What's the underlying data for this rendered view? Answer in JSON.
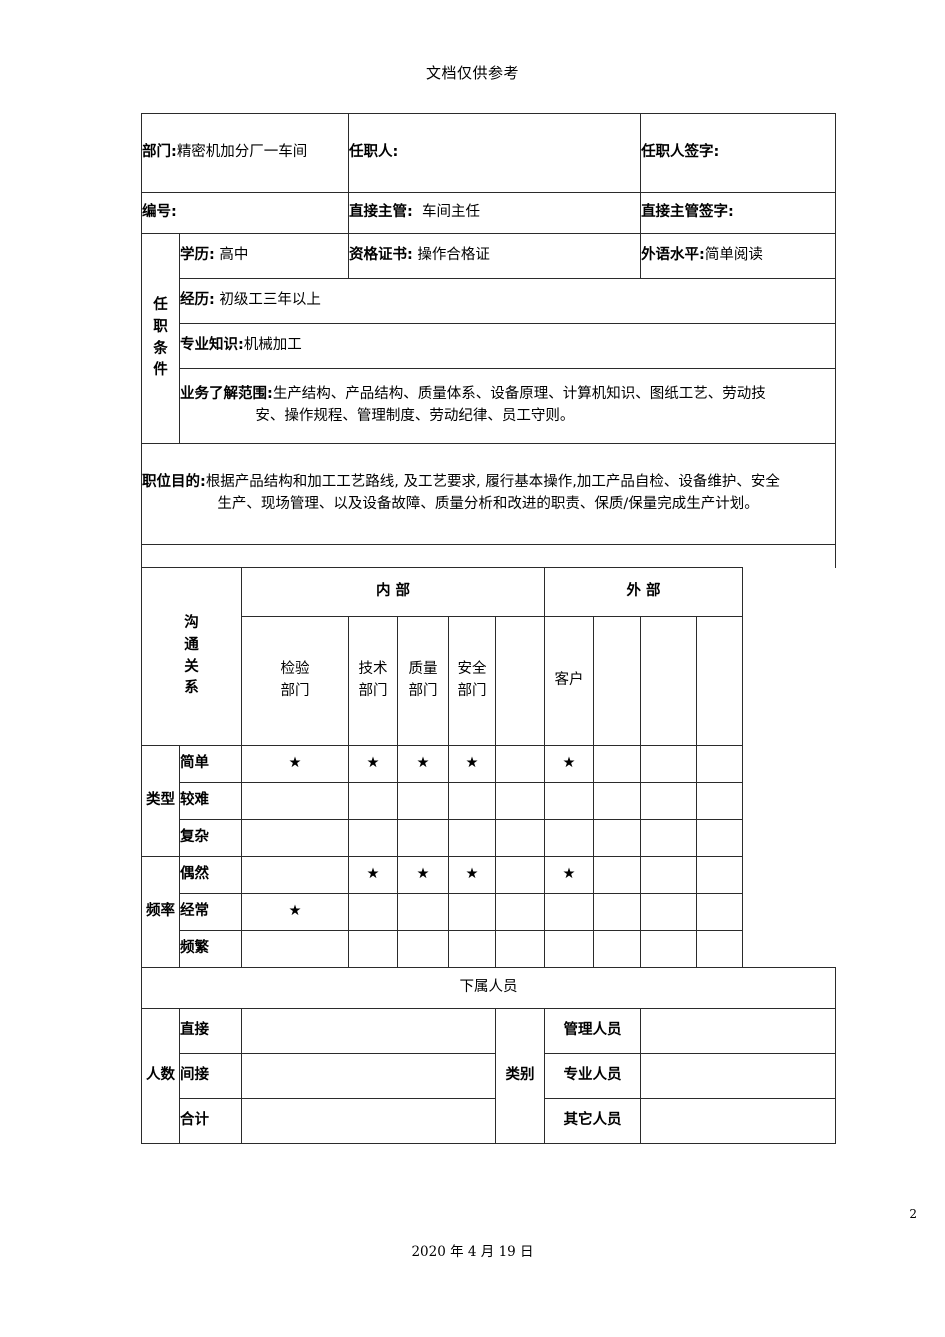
{
  "document": {
    "header_note": "文档仅供参考",
    "footer_date": "2020 年 4 月 19 日",
    "page_number": "2"
  },
  "identity": {
    "department_label": "部门:",
    "department_value": "精密机加分厂一车间",
    "department_full": "部门:精密机加分厂一车间",
    "incumbent_label": "任职人:",
    "incumbent_value": "",
    "incumbent_signature_label": "任职人签字:",
    "incumbent_signature_value": "",
    "number_label": "编号:",
    "number_value": "",
    "supervisor_label": "直接主管:",
    "supervisor_value": "车间主任",
    "supervisor_signature_label": "直接主管签字:",
    "supervisor_signature_value": ""
  },
  "qualifications": {
    "section_label": "任职条件",
    "section_label_chars": [
      "任",
      "职",
      "条",
      "件"
    ],
    "education_label": "学历:",
    "education_value": "高中",
    "certificate_label": "资格证书:",
    "certificate_value": "操作合格证",
    "language_label": "外语水平:",
    "language_value": "简单阅读",
    "experience_label": "经历:",
    "experience_value": "初级工三年以上",
    "knowledge_label": "专业知识:",
    "knowledge_value": "机械加工",
    "business_scope_label": "业务了解范围:",
    "business_scope_line1": "生产结构、产品结构、质量体系、设备原理、计算机知识、图纸工艺、劳动技",
    "business_scope_line2": "安、操作规程、管理制度、劳动纪律、员工守则。"
  },
  "purpose": {
    "label": "职位目的:",
    "line1": "根据产品结构和加工工艺路线, 及工艺要求, 履行基本操作,加工产品自检、设备维护、安全",
    "line2": "生产、现场管理、以及设备故障、质量分析和改进的职责、保质/保量完成生产计划。"
  },
  "communication": {
    "title_chars": [
      "沟",
      "通",
      "关",
      "系"
    ],
    "title": "沟通关系",
    "group_internal": "内  部",
    "group_external": "外  部",
    "internal_columns": [
      {
        "line1": "检验",
        "line2": "部门"
      },
      {
        "line1": "技术",
        "line2": "部门"
      },
      {
        "line1": "质量",
        "line2": "部门"
      },
      {
        "line1": "安全",
        "line2": "部门"
      },
      {
        "line1": "",
        "line2": ""
      }
    ],
    "external_columns": [
      {
        "line1": "客户",
        "line2": ""
      },
      {
        "line1": "",
        "line2": ""
      },
      {
        "line1": "",
        "line2": ""
      },
      {
        "line1": "",
        "line2": ""
      }
    ],
    "type_label": "类型",
    "type_rows": [
      {
        "label": "简单",
        "marks": [
          "★",
          "★",
          "★",
          "★",
          "",
          "★",
          "",
          "",
          ""
        ]
      },
      {
        "label": "较难",
        "marks": [
          "",
          "",
          "",
          "",
          "",
          "",
          "",
          "",
          ""
        ]
      },
      {
        "label": "复杂",
        "marks": [
          "",
          "",
          "",
          "",
          "",
          "",
          "",
          "",
          ""
        ]
      }
    ],
    "frequency_label": "频率",
    "frequency_rows": [
      {
        "label": "偶然",
        "marks": [
          "",
          "★",
          "★",
          "★",
          "",
          "★",
          "",
          "",
          ""
        ]
      },
      {
        "label": "经常",
        "marks": [
          "★",
          "",
          "",
          "",
          "",
          "",
          "",
          "",
          ""
        ]
      },
      {
        "label": "频繁",
        "marks": [
          "",
          "",
          "",
          "",
          "",
          "",
          "",
          "",
          ""
        ]
      }
    ]
  },
  "subordinates": {
    "banner": "下属人员",
    "count_label": "人数",
    "count_rows": [
      {
        "label": "直接",
        "value": ""
      },
      {
        "label": "间接",
        "value": ""
      },
      {
        "label": "合计",
        "value": ""
      }
    ],
    "category_label": "类别",
    "category_rows": [
      {
        "label": "管理人员",
        "value": ""
      },
      {
        "label": "专业人员",
        "value": ""
      },
      {
        "label": "其它人员",
        "value": ""
      }
    ]
  }
}
